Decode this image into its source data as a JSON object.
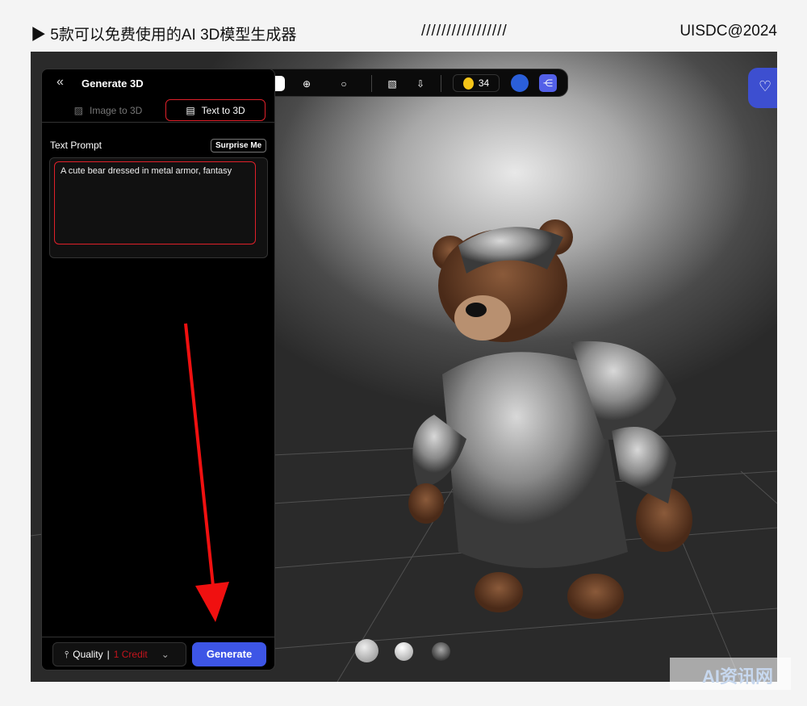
{
  "header": {
    "title": "▶ 5款可以免费使用的AI 3D模型生成器",
    "divider": "/////////////////",
    "brand": "UISDC@2024"
  },
  "panel": {
    "title": "Generate 3D",
    "tabs": [
      {
        "label": "Image to 3D",
        "active": false
      },
      {
        "label": "Text to 3D",
        "active": true
      }
    ],
    "prompt_label": "Text Prompt",
    "surprise_label": "Surprise Me",
    "prompt_value": "A cute bear dressed in metal armor, fantasy",
    "quality_label": "Quality",
    "quality_sep": "|",
    "credit_label": "1 Credit",
    "generate_label": "Generate"
  },
  "toolbar": {
    "credits": "34"
  },
  "watermark": "AI资讯网",
  "colors": {
    "accent": "#3d55e6",
    "highlight": "#e0202a",
    "credit": "#c4141c"
  }
}
